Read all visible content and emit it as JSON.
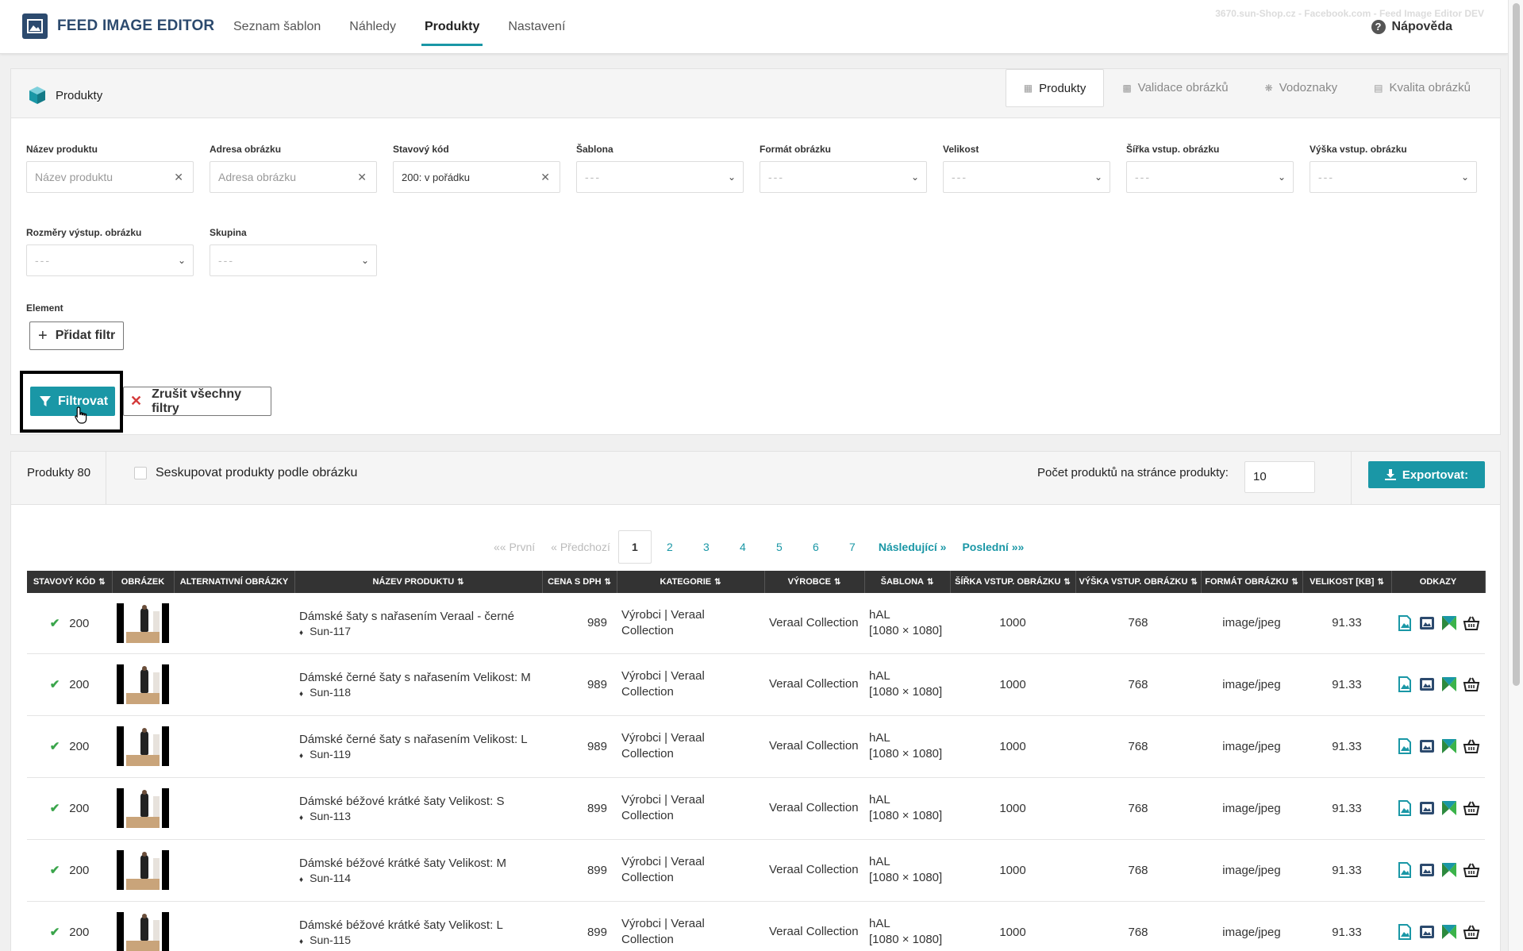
{
  "app": {
    "title": "FEED IMAGE EDITOR",
    "env_info": "3670.sun-Shop.cz - Facebook.com - Feed Image Editor DEV",
    "help_label": "Nápověda",
    "accent": "#1a97a6"
  },
  "nav": [
    "Seznam šablon",
    "Náhledy",
    "Produkty",
    "Nastavení"
  ],
  "nav_active": "Produkty",
  "panel": {
    "title": "Produkty",
    "tabs": [
      {
        "label": "Produkty",
        "icon": "cube-icon"
      },
      {
        "label": "Validace obrázků",
        "icon": "image-check-icon"
      },
      {
        "label": "Vodoznaky",
        "icon": "paw-icon"
      },
      {
        "label": "Kvalita obrázků",
        "icon": "image-icon"
      }
    ]
  },
  "filters": {
    "name": {
      "label": "Název produktu",
      "placeholder": "Název produktu"
    },
    "image_url": {
      "label": "Adresa obrázku",
      "placeholder": "Adresa obrázku"
    },
    "status": {
      "label": "Stavový kód",
      "value": "200: v pořádku"
    },
    "template": {
      "label": "Šablona",
      "value": "---"
    },
    "format": {
      "label": "Formát obrázku",
      "value": "---"
    },
    "size": {
      "label": "Velikost",
      "value": "---"
    },
    "in_width": {
      "label": "Šířka vstup. obrázku",
      "value": "---"
    },
    "in_height": {
      "label": "Výška vstup. obrázku",
      "value": "---"
    },
    "out_dims": {
      "label": "Rozměry výstup. obrázku",
      "value": "---"
    },
    "group": {
      "label": "Skupina",
      "value": "---"
    },
    "element_label": "Element",
    "add_filter": "Přidat filtr",
    "apply": "Filtrovat",
    "clear": "Zrušit všechny filtry"
  },
  "products_bar": {
    "count_label": "Produkty 80",
    "group_label": "Seskupovat produkty podle obrázku",
    "per_page_label": "Počet produktů na stránce produkty:",
    "per_page_value": "10",
    "export_label": "Exportovat:"
  },
  "pagination": {
    "first": "«« První",
    "prev": "« Předchozí",
    "pages": [
      "1",
      "2",
      "3",
      "4",
      "5",
      "6",
      "7"
    ],
    "current": "1",
    "next": "Následující »",
    "last": "Poslední »»"
  },
  "table": {
    "columns": [
      "Stavový kód",
      "Obrázek",
      "Alternativní obrázky",
      "Název produktu",
      "Cena s DPH",
      "Kategorie",
      "Výrobce",
      "Šablona",
      "Šířka vstup. obrázku",
      "Výška vstup. obrázku",
      "Formát obrázku",
      "Velikost [kB]",
      "Odkazy"
    ],
    "rows": [
      {
        "status": "200",
        "name": "Dámské šaty s nařasením Veraal - černé",
        "sku": "Sun-117",
        "price": "989",
        "category": "Výrobci | Veraal Collection",
        "maker": "Veraal Collection",
        "template": "hAL",
        "template_size": "[1080 × 1080]",
        "width": "1000",
        "height": "768",
        "format": "image/jpeg",
        "size": "91.33"
      },
      {
        "status": "200",
        "name": "Dámské černé šaty s nařasením Velikost: M",
        "sku": "Sun-118",
        "price": "989",
        "category": "Výrobci | Veraal Collection",
        "maker": "Veraal Collection",
        "template": "hAL",
        "template_size": "[1080 × 1080]",
        "width": "1000",
        "height": "768",
        "format": "image/jpeg",
        "size": "91.33"
      },
      {
        "status": "200",
        "name": "Dámské černé šaty s nařasením Velikost: L",
        "sku": "Sun-119",
        "price": "989",
        "category": "Výrobci | Veraal Collection",
        "maker": "Veraal Collection",
        "template": "hAL",
        "template_size": "[1080 × 1080]",
        "width": "1000",
        "height": "768",
        "format": "image/jpeg",
        "size": "91.33"
      },
      {
        "status": "200",
        "name": "Dámské béžové krátké šaty Velikost: S",
        "sku": "Sun-113",
        "price": "899",
        "category": "Výrobci | Veraal Collection",
        "maker": "Veraal Collection",
        "template": "hAL",
        "template_size": "[1080 × 1080]",
        "width": "1000",
        "height": "768",
        "format": "image/jpeg",
        "size": "91.33"
      },
      {
        "status": "200",
        "name": "Dámské béžové krátké šaty Velikost: M",
        "sku": "Sun-114",
        "price": "899",
        "category": "Výrobci | Veraal Collection",
        "maker": "Veraal Collection",
        "template": "hAL",
        "template_size": "[1080 × 1080]",
        "width": "1000",
        "height": "768",
        "format": "image/jpeg",
        "size": "91.33"
      },
      {
        "status": "200",
        "name": "Dámské béžové krátké šaty Velikost: L",
        "sku": "Sun-115",
        "price": "899",
        "category": "Výrobci | Veraal Collection",
        "maker": "Veraal Collection",
        "template": "hAL",
        "template_size": "[1080 × 1080]",
        "width": "1000",
        "height": "768",
        "format": "image/jpeg",
        "size": "91.33"
      }
    ]
  }
}
